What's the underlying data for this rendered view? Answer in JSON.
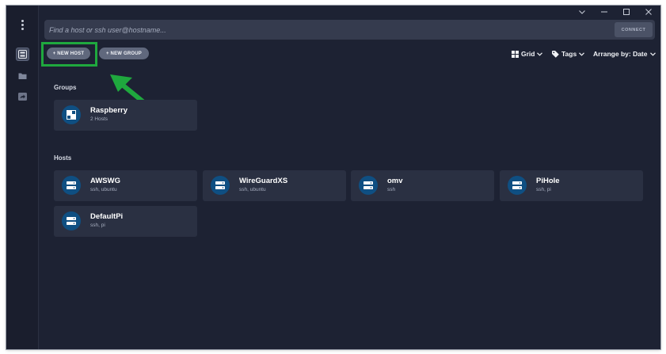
{
  "window": {
    "controls": [
      "chevron-down-icon",
      "minimize-icon",
      "maximize-icon",
      "close-icon"
    ]
  },
  "search": {
    "placeholder": "Find a host or ssh user@hostname...",
    "connect_label": "CONNECT"
  },
  "toolbar": {
    "new_host_label": "+ NEW HOST",
    "new_group_label": "+ NEW GROUP",
    "view_label": "Grid",
    "tags_label": "Tags",
    "sort_label": "Arrange by: Date"
  },
  "groups": {
    "heading": "Groups",
    "items": [
      {
        "name": "Raspberry",
        "subtitle": "2 Hosts"
      }
    ]
  },
  "hosts": {
    "heading": "Hosts",
    "items": [
      {
        "name": "AWSWG",
        "subtitle": "ssh, ubuntu"
      },
      {
        "name": "WireGuardXS",
        "subtitle": "ssh, ubuntu"
      },
      {
        "name": "omv",
        "subtitle": "ssh"
      },
      {
        "name": "PiHole",
        "subtitle": "ssh, pi"
      },
      {
        "name": "DefaultPi",
        "subtitle": "ssh, pi"
      }
    ]
  },
  "colors": {
    "background": "#1d2233",
    "card": "#2a3042",
    "accent": "#0f4f82",
    "annotation": "#1fa83e"
  }
}
